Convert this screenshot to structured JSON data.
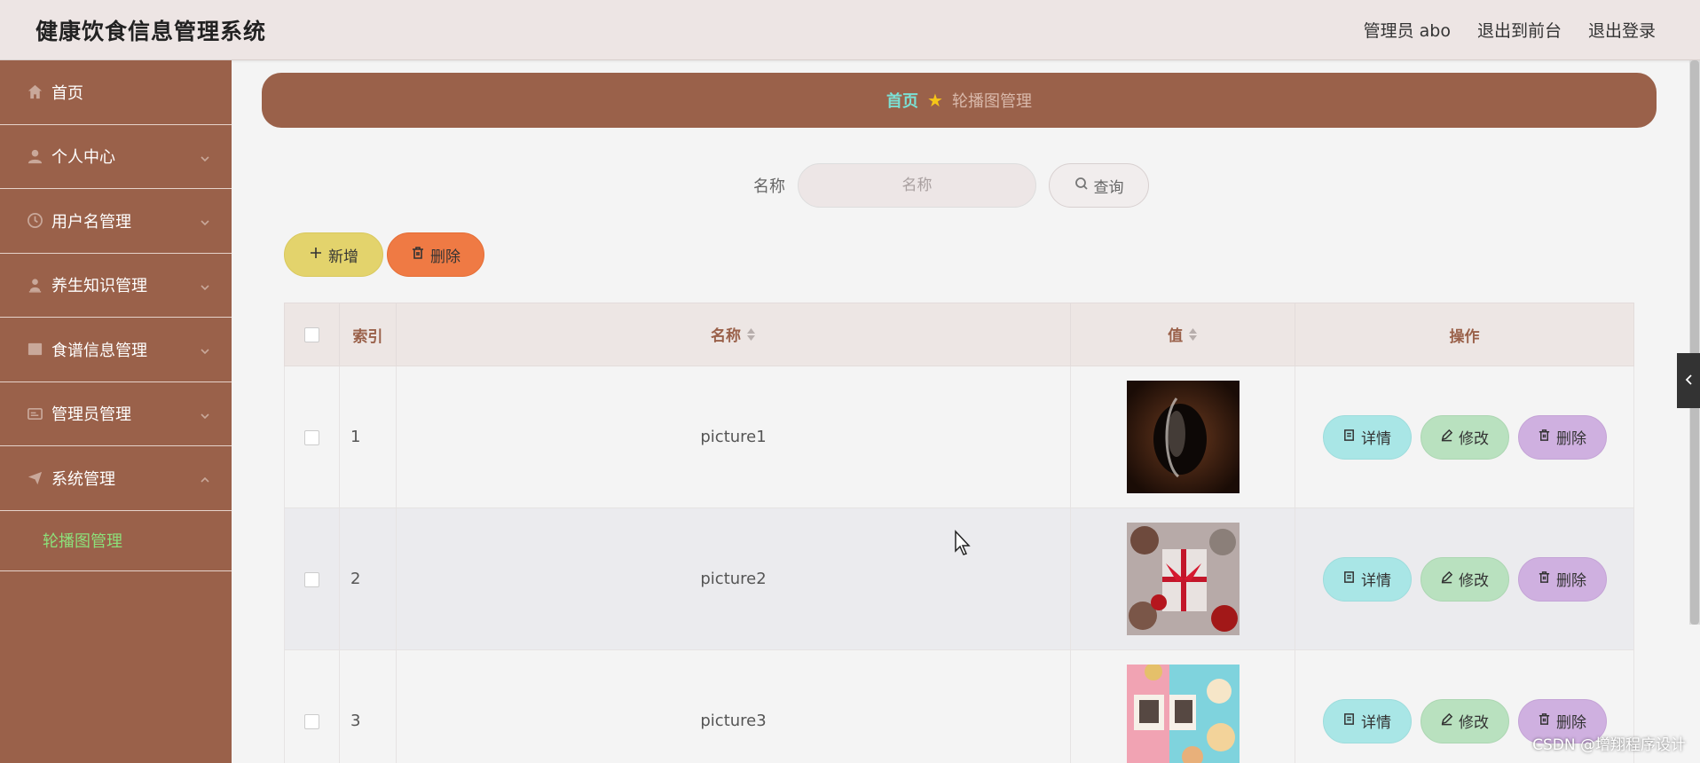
{
  "header": {
    "title": "健康饮食信息管理系统",
    "admin_label": "管理员 abo",
    "to_front": "退出到前台",
    "logout": "退出登录"
  },
  "sidebar": {
    "items": [
      {
        "label": "首页",
        "icon": "home-icon",
        "has_chevron": false
      },
      {
        "label": "个人中心",
        "icon": "user-icon",
        "has_chevron": true
      },
      {
        "label": "用户名管理",
        "icon": "clock-icon",
        "has_chevron": true
      },
      {
        "label": "养生知识管理",
        "icon": "person-icon",
        "has_chevron": true
      },
      {
        "label": "食谱信息管理",
        "icon": "chart-icon",
        "has_chevron": true
      },
      {
        "label": "管理员管理",
        "icon": "id-card-icon",
        "has_chevron": true
      },
      {
        "label": "系统管理",
        "icon": "paper-plane-icon",
        "has_chevron": true,
        "expanded": true
      }
    ],
    "sub_item": "轮播图管理"
  },
  "breadcrumb": {
    "home": "首页",
    "current": "轮播图管理"
  },
  "search": {
    "label": "名称",
    "placeholder": "名称",
    "button": "查询"
  },
  "actions": {
    "add": "新增",
    "delete": "删除"
  },
  "table": {
    "headers": {
      "index": "索引",
      "name": "名称",
      "value": "值",
      "ops": "操作"
    },
    "rows": [
      {
        "index": "1",
        "name": "picture1",
        "image": "coffee-image"
      },
      {
        "index": "2",
        "name": "picture2",
        "image": "gift-food-image"
      },
      {
        "index": "3",
        "name": "picture3",
        "image": "japanese-food-image"
      }
    ],
    "row_buttons": {
      "detail": "详情",
      "edit": "修改",
      "remove": "删除"
    }
  },
  "watermark": "CSDN @增翔程序设计",
  "colors": {
    "sidebar": "#9a614a",
    "header": "#ede5e4",
    "add_button": "#e3d36c",
    "delete_button": "#ef7a44",
    "detail_button": "#a9e6e6",
    "edit_button": "#b9e1bf",
    "remove_button": "#cfb0e0",
    "active_sub_item": "#8ce07a"
  }
}
